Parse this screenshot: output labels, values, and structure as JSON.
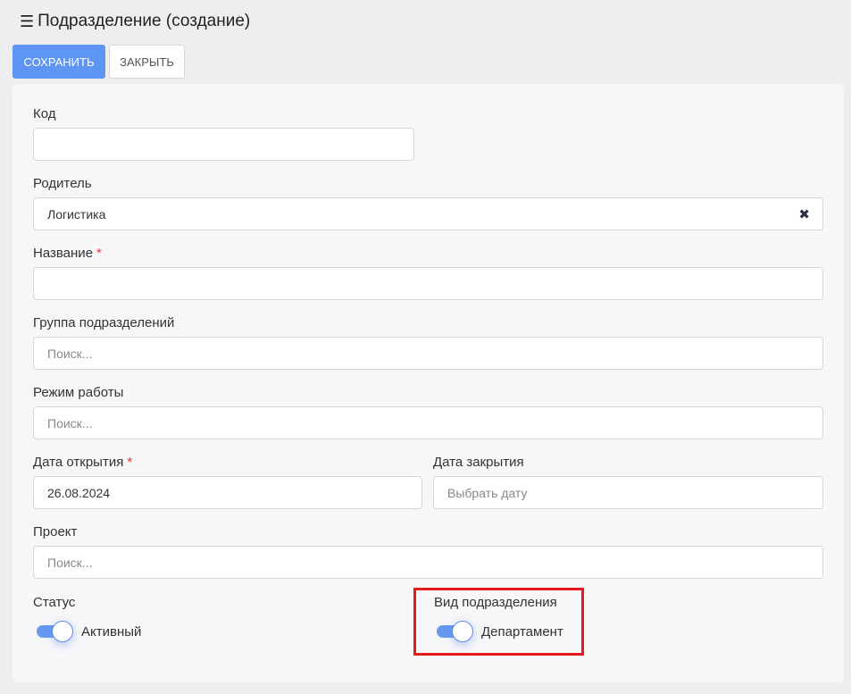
{
  "header": {
    "menu_icon": "☰",
    "title": "Подразделение (создание)"
  },
  "toolbar": {
    "save_label": "СОХРАНИТЬ",
    "close_label": "ЗАКРЫТЬ"
  },
  "form": {
    "code": {
      "label": "Код",
      "value": ""
    },
    "parent": {
      "label": "Родитель",
      "value": "Логистика",
      "clear_icon": "✖"
    },
    "name": {
      "label": "Название",
      "required_mark": "*",
      "value": ""
    },
    "group": {
      "label": "Группа подразделений",
      "placeholder": "Поиск..."
    },
    "schedule": {
      "label": "Режим работы",
      "placeholder": "Поиск..."
    },
    "open_date": {
      "label": "Дата открытия",
      "required_mark": "*",
      "value": "26.08.2024"
    },
    "close_date": {
      "label": "Дата закрытия",
      "placeholder": "Выбрать дату"
    },
    "project": {
      "label": "Проект",
      "placeholder": "Поиск..."
    },
    "status": {
      "label": "Статус",
      "toggle_text": "Активный",
      "on": true
    },
    "unit_type": {
      "label": "Вид подразделения",
      "toggle_text": "Департамент",
      "on": true
    }
  },
  "colors": {
    "primary": "#5f95f2",
    "highlight": "#e21b1b",
    "required": "#e53935"
  }
}
